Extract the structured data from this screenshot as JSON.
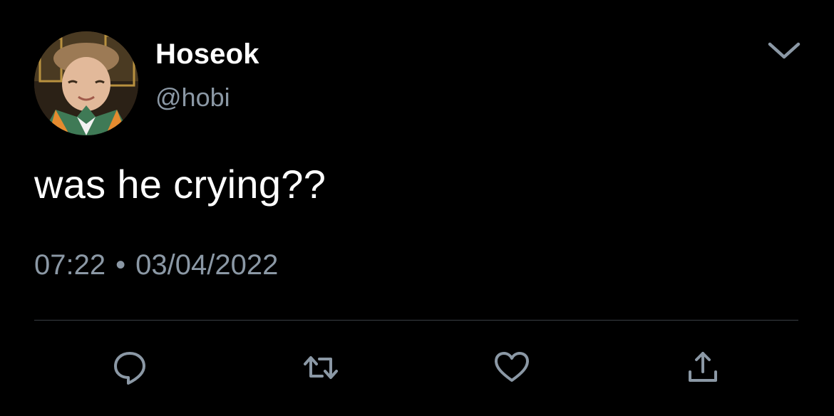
{
  "tweet": {
    "display_name": "Hoseok",
    "handle": "@hobi",
    "text": "was he crying??",
    "time": "07:22",
    "separator": "•",
    "date": "03/04/2022"
  },
  "icons": {
    "more": "chevron-down-icon",
    "reply": "reply-icon",
    "retweet": "retweet-icon",
    "like": "heart-icon",
    "share": "share-icon"
  },
  "colors": {
    "background": "#000000",
    "primary_text": "#ffffff",
    "secondary_text": "#8b98a5",
    "divider": "#3a3f44"
  }
}
